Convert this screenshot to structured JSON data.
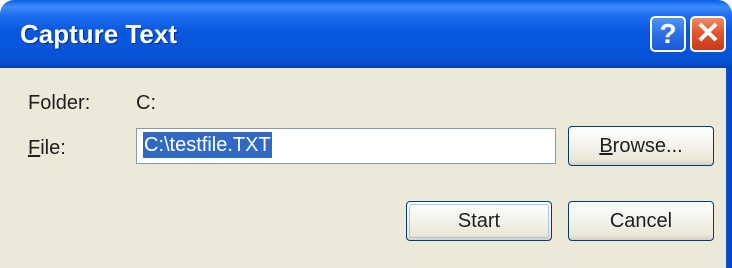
{
  "window": {
    "title": "Capture Text",
    "help_glyph": "?",
    "close_glyph": "✕"
  },
  "form": {
    "folder_label_accel": "",
    "folder_label": "Folder:",
    "folder_value": "C:",
    "file_label_accel": "F",
    "file_label_rest": "ile:",
    "file_value": "C:\\testfile.TXT"
  },
  "buttons": {
    "browse_accel": "B",
    "browse_rest": "rowse...",
    "start": "Start",
    "cancel": "Cancel"
  },
  "colors": {
    "titlebar": "#0a58e0",
    "client_bg": "#ece9d8",
    "selection": "#316ac5",
    "close_button": "#e2562f"
  }
}
